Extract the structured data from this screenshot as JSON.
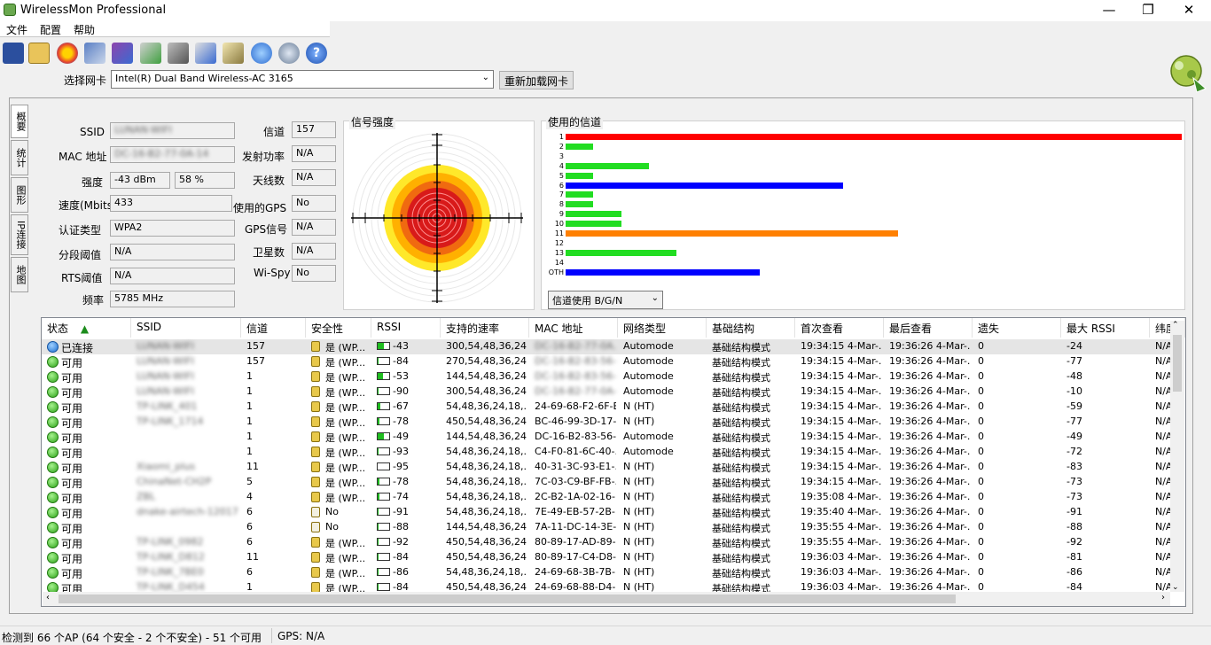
{
  "window": {
    "title": "WirelessMon Professional",
    "minimize": "—",
    "maximize": "❐",
    "close": "✕"
  },
  "menu": [
    "文件",
    "配置",
    "帮助"
  ],
  "adapter": {
    "label": "选择网卡",
    "value": "Intel(R) Dual Band Wireless-AC 3165",
    "reload": "重新加载网卡"
  },
  "vtabs": [
    "概要",
    "统计",
    "图形",
    "IP连接",
    "地图"
  ],
  "info": {
    "ssid_label": "SSID",
    "ssid": "LUNAN-WIFI",
    "mac_label": "MAC 地址",
    "mac": "DC-16-B2-77-0A-14",
    "strength_label": "强度",
    "strength_dbm": "-43 dBm",
    "strength_pct": "58 %",
    "speed_label": "速度(Mbits)",
    "speed": "433",
    "auth_label": "认证类型",
    "auth": "WPA2",
    "frag_label": "分段阈值",
    "frag": "N/A",
    "rts_label": "RTS阈值",
    "rts": "N/A",
    "freq_label": "频率",
    "freq": "5785 MHz",
    "channel_label": "信道",
    "channel": "157",
    "txpower_label": "发射功率",
    "txpower": "N/A",
    "antenna_label": "天线数",
    "antenna": "N/A",
    "gps_used_label": "使用的GPS",
    "gps_used": "No",
    "gps_signal_label": "GPS信号",
    "gps_signal": "N/A",
    "satellite_label": "卫星数",
    "satellite": "N/A",
    "wispy_label": "Wi-Spy",
    "wispy": "No"
  },
  "signal_title": "信号强度",
  "channels": {
    "title": "使用的信道",
    "mode": "信道使用 B/G/N",
    "labels": [
      "1",
      "2",
      "3",
      "4",
      "5",
      "6",
      "7",
      "8",
      "9",
      "10",
      "11",
      "12",
      "13",
      "14",
      "OTH"
    ],
    "fractions": [
      1.0,
      0.045,
      0,
      0.135,
      0.045,
      0.45,
      0.045,
      0.045,
      0.09,
      0.09,
      0.54,
      0,
      0.18,
      0,
      0.315
    ],
    "colors": [
      "#ff0000",
      "#22dd22",
      "#22dd22",
      "#22dd22",
      "#22dd22",
      "#0000ff",
      "#22dd22",
      "#22dd22",
      "#22dd22",
      "#22dd22",
      "#ff8000",
      "#22dd22",
      "#22dd22",
      "#22dd22",
      "#0000ff"
    ]
  },
  "table": {
    "columns": [
      "状态",
      "SSID",
      "信道",
      "安全性",
      "RSSI",
      "支持的速率",
      "MAC 地址",
      "网络类型",
      "基础结构",
      "首次查看",
      "最后查看",
      "遗失",
      "最大 RSSI",
      "纬度"
    ],
    "rows": [
      {
        "status": "已连接",
        "ssid": "LUNAN-WIFI",
        "ch": "157",
        "sec": "是 (WP...",
        "rssi": "-43",
        "rates": "300,54,48,36,24...",
        "mac": "DC-16-B2-77-0A...",
        "type": "Automode",
        "infra": "基础结构模式",
        "first": "19:34:15 4-Mar-...",
        "last": "19:36:26 4-Mar-...",
        "lost": "0",
        "max": "-24",
        "lat": "N/A",
        "lvl": 0.55,
        "conn": true
      },
      {
        "status": "可用",
        "ssid": "LUNAN-WIFI",
        "ch": "157",
        "sec": "是 (WP...",
        "rssi": "-84",
        "rates": "270,54,48,36,24...",
        "mac": "DC-16-B2-83-56-...",
        "type": "Automode",
        "infra": "基础结构模式",
        "first": "19:34:15 4-Mar-...",
        "last": "19:36:26 4-Mar-...",
        "lost": "0",
        "max": "-77",
        "lat": "N/A",
        "lvl": 0.1
      },
      {
        "status": "可用",
        "ssid": "LUNAN-WIFI",
        "ch": "1",
        "sec": "是 (WP...",
        "rssi": "-53",
        "rates": "144,54,48,36,24...",
        "mac": "DC-16-B2-83-56-...",
        "type": "Automode",
        "infra": "基础结构模式",
        "first": "19:34:15 4-Mar-...",
        "last": "19:36:26 4-Mar-...",
        "lost": "0",
        "max": "-48",
        "lat": "N/A",
        "lvl": 0.45
      },
      {
        "status": "可用",
        "ssid": "LUNAN-WIFI",
        "ch": "1",
        "sec": "是 (WP...",
        "rssi": "-90",
        "rates": "300,54,48,36,24...",
        "mac": "DC-16-B2-77-0A-...",
        "type": "Automode",
        "infra": "基础结构模式",
        "first": "19:34:15 4-Mar-...",
        "last": "19:36:26 4-Mar-...",
        "lost": "0",
        "max": "-10",
        "lat": "N/A",
        "lvl": 0.05
      },
      {
        "status": "可用",
        "ssid": "TP-LINK_401",
        "ch": "1",
        "sec": "是 (WP...",
        "rssi": "-67",
        "rates": "54,48,36,24,18,...",
        "mac": "24-69-68-F2-6F-E4",
        "type": "N (HT)",
        "infra": "基础结构模式",
        "first": "19:34:15 4-Mar-...",
        "last": "19:36:26 4-Mar-...",
        "lost": "0",
        "max": "-59",
        "lat": "N/A",
        "lvl": 0.25
      },
      {
        "status": "可用",
        "ssid": "TP-LINK_1714",
        "ch": "1",
        "sec": "是 (WP...",
        "rssi": "-78",
        "rates": "450,54,48,36,24...",
        "mac": "BC-46-99-3D-17-...",
        "type": "N (HT)",
        "infra": "基础结构模式",
        "first": "19:34:15 4-Mar-...",
        "last": "19:36:26 4-Mar-...",
        "lost": "0",
        "max": "-77",
        "lat": "N/A",
        "lvl": 0.12
      },
      {
        "status": "可用",
        "ssid": "",
        "ch": "1",
        "sec": "是 (WP...",
        "rssi": "-49",
        "rates": "144,54,48,36,24...",
        "mac": "DC-16-B2-83-56-...",
        "type": "Automode",
        "infra": "基础结构模式",
        "first": "19:34:15 4-Mar-...",
        "last": "19:36:26 4-Mar-...",
        "lost": "0",
        "max": "-49",
        "lat": "N/A",
        "lvl": 0.5
      },
      {
        "status": "可用",
        "ssid": "",
        "ch": "1",
        "sec": "是 (WP...",
        "rssi": "-93",
        "rates": "54,48,36,24,18,...",
        "mac": "C4-F0-81-6C-40-...",
        "type": "Automode",
        "infra": "基础结构模式",
        "first": "19:34:15 4-Mar-...",
        "last": "19:36:26 4-Mar-...",
        "lost": "0",
        "max": "-72",
        "lat": "N/A",
        "lvl": 0.04
      },
      {
        "status": "可用",
        "ssid": "Xiaomi_plus",
        "ch": "11",
        "sec": "是 (WP...",
        "rssi": "-95",
        "rates": "54,48,36,24,18,...",
        "mac": "40-31-3C-93-E1-...",
        "type": "N (HT)",
        "infra": "基础结构模式",
        "first": "19:34:15 4-Mar-...",
        "last": "19:36:26 4-Mar-...",
        "lost": "0",
        "max": "-83",
        "lat": "N/A",
        "lvl": 0.03
      },
      {
        "status": "可用",
        "ssid": "ChinaNet-CH2P",
        "ch": "5",
        "sec": "是 (WP...",
        "rssi": "-78",
        "rates": "54,48,36,24,18,...",
        "mac": "7C-03-C9-BF-FB-...",
        "type": "N (HT)",
        "infra": "基础结构模式",
        "first": "19:34:15 4-Mar-...",
        "last": "19:36:26 4-Mar-...",
        "lost": "0",
        "max": "-73",
        "lat": "N/A",
        "lvl": 0.12
      },
      {
        "status": "可用",
        "ssid": "ZBL",
        "ch": "4",
        "sec": "是 (WP...",
        "rssi": "-74",
        "rates": "54,48,36,24,18,...",
        "mac": "2C-B2-1A-02-16-...",
        "type": "N (HT)",
        "infra": "基础结构模式",
        "first": "19:35:08 4-Mar-...",
        "last": "19:36:26 4-Mar-...",
        "lost": "0",
        "max": "-73",
        "lat": "N/A",
        "lvl": 0.15
      },
      {
        "status": "可用",
        "ssid": "dnake-airtech-12017",
        "ch": "6",
        "sec": "No",
        "rssi": "-91",
        "rates": "54,48,36,24,18,...",
        "mac": "7E-49-EB-57-2B-...",
        "type": "N (HT)",
        "infra": "基础结构模式",
        "first": "19:35:40 4-Mar-...",
        "last": "19:36:26 4-Mar-...",
        "lost": "0",
        "max": "-91",
        "lat": "N/A",
        "lvl": 0.04,
        "open": true
      },
      {
        "status": "可用",
        "ssid": "",
        "ch": "6",
        "sec": "No",
        "rssi": "-88",
        "rates": "144,54,48,36,24...",
        "mac": "7A-11-DC-14-3E-...",
        "type": "N (HT)",
        "infra": "基础结构模式",
        "first": "19:35:55 4-Mar-...",
        "last": "19:36:26 4-Mar-...",
        "lost": "0",
        "max": "-88",
        "lat": "N/A",
        "lvl": 0.05,
        "open": true
      },
      {
        "status": "可用",
        "ssid": "TP-LINK_0982",
        "ch": "6",
        "sec": "是 (WP...",
        "rssi": "-92",
        "rates": "450,54,48,36,24...",
        "mac": "80-89-17-AD-89-...",
        "type": "N (HT)",
        "infra": "基础结构模式",
        "first": "19:35:55 4-Mar-...",
        "last": "19:36:26 4-Mar-...",
        "lost": "0",
        "max": "-92",
        "lat": "N/A",
        "lvl": 0.04
      },
      {
        "status": "可用",
        "ssid": "TP-LINK_D812",
        "ch": "11",
        "sec": "是 (WP...",
        "rssi": "-84",
        "rates": "450,54,48,36,24...",
        "mac": "80-89-17-C4-D8-...",
        "type": "N (HT)",
        "infra": "基础结构模式",
        "first": "19:36:03 4-Mar-...",
        "last": "19:36:26 4-Mar-...",
        "lost": "0",
        "max": "-81",
        "lat": "N/A",
        "lvl": 0.08
      },
      {
        "status": "可用",
        "ssid": "TP-LINK_7BE0",
        "ch": "6",
        "sec": "是 (WP...",
        "rssi": "-86",
        "rates": "54,48,36,24,18,...",
        "mac": "24-69-68-3B-7B-...",
        "type": "N (HT)",
        "infra": "基础结构模式",
        "first": "19:36:03 4-Mar-...",
        "last": "19:36:26 4-Mar-...",
        "lost": "0",
        "max": "-86",
        "lat": "N/A",
        "lvl": 0.07
      },
      {
        "status": "可用",
        "ssid": "TP-LINK_D454",
        "ch": "1",
        "sec": "是 (WP...",
        "rssi": "-84",
        "rates": "450,54,48,36,24...",
        "mac": "24-69-68-88-D4-...",
        "type": "N (HT)",
        "infra": "基础结构模式",
        "first": "19:36:03 4-Mar-...",
        "last": "19:36:26 4-Mar-...",
        "lost": "0",
        "max": "-84",
        "lat": "N/A",
        "lvl": 0.08
      }
    ]
  },
  "status": {
    "summary": "检测到 66 个AP (64 个安全 - 2 个不安全) - 51 个可用",
    "gps": "GPS: N/A"
  }
}
